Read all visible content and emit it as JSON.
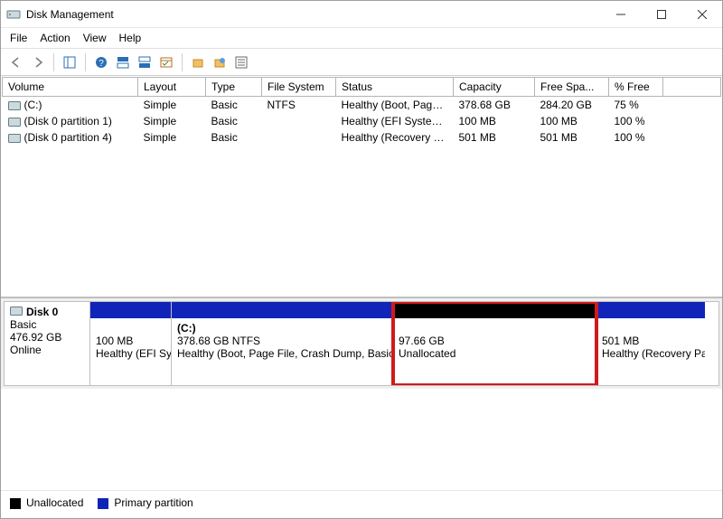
{
  "window": {
    "title": "Disk Management"
  },
  "menu": {
    "file": "File",
    "action": "Action",
    "view": "View",
    "help": "Help"
  },
  "columns": {
    "volume": "Volume",
    "layout": "Layout",
    "type": "Type",
    "file_system": "File System",
    "status": "Status",
    "capacity": "Capacity",
    "free": "Free Spa...",
    "pfree": "% Free"
  },
  "volumes": [
    {
      "name": "(C:)",
      "layout": "Simple",
      "type": "Basic",
      "fs": "NTFS",
      "status": "Healthy (Boot, Page ...",
      "capacity": "378.68 GB",
      "free": "284.20 GB",
      "pfree": "75 %"
    },
    {
      "name": "(Disk 0 partition 1)",
      "layout": "Simple",
      "type": "Basic",
      "fs": "",
      "status": "Healthy (EFI System ...",
      "capacity": "100 MB",
      "free": "100 MB",
      "pfree": "100 %"
    },
    {
      "name": "(Disk 0 partition 4)",
      "layout": "Simple",
      "type": "Basic",
      "fs": "",
      "status": "Healthy (Recovery Pa...",
      "capacity": "501 MB",
      "free": "501 MB",
      "pfree": "100 %"
    }
  ],
  "disk": {
    "label": "Disk 0",
    "type": "Basic",
    "size": "476.92 GB",
    "state": "Online",
    "partitions": [
      {
        "line1": "",
        "line2": "100 MB",
        "line3": "Healthy (EFI Sy",
        "bar": "blue",
        "flex": 90
      },
      {
        "line1": "(C:)",
        "line1bold": true,
        "line2": "378.68 GB NTFS",
        "line3": "Healthy (Boot, Page File, Crash Dump, Basic Da",
        "bar": "blue",
        "flex": 245
      },
      {
        "line1": "",
        "line2": "97.66 GB",
        "line3": "Unallocated",
        "bar": "black",
        "flex": 225,
        "highlight": true
      },
      {
        "line1": "",
        "line2": "501 MB",
        "line3": "Healthy (Recovery Pa",
        "bar": "blue",
        "flex": 120
      }
    ]
  },
  "legend": {
    "unalloc": "Unallocated",
    "primary": "Primary partition"
  }
}
